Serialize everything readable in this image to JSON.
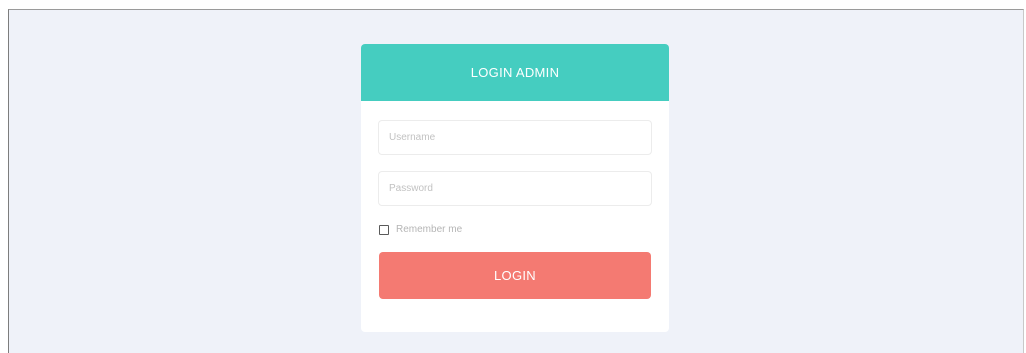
{
  "login_card": {
    "title": "LOGIN ADMIN",
    "username_placeholder": "Username",
    "password_placeholder": "Password",
    "remember_label": "Remember me",
    "remember_checked": false,
    "submit_label": "LOGIN"
  },
  "colors": {
    "page_background": "#eff2f9",
    "header": "#45cdc0",
    "button": "#f47a72"
  }
}
